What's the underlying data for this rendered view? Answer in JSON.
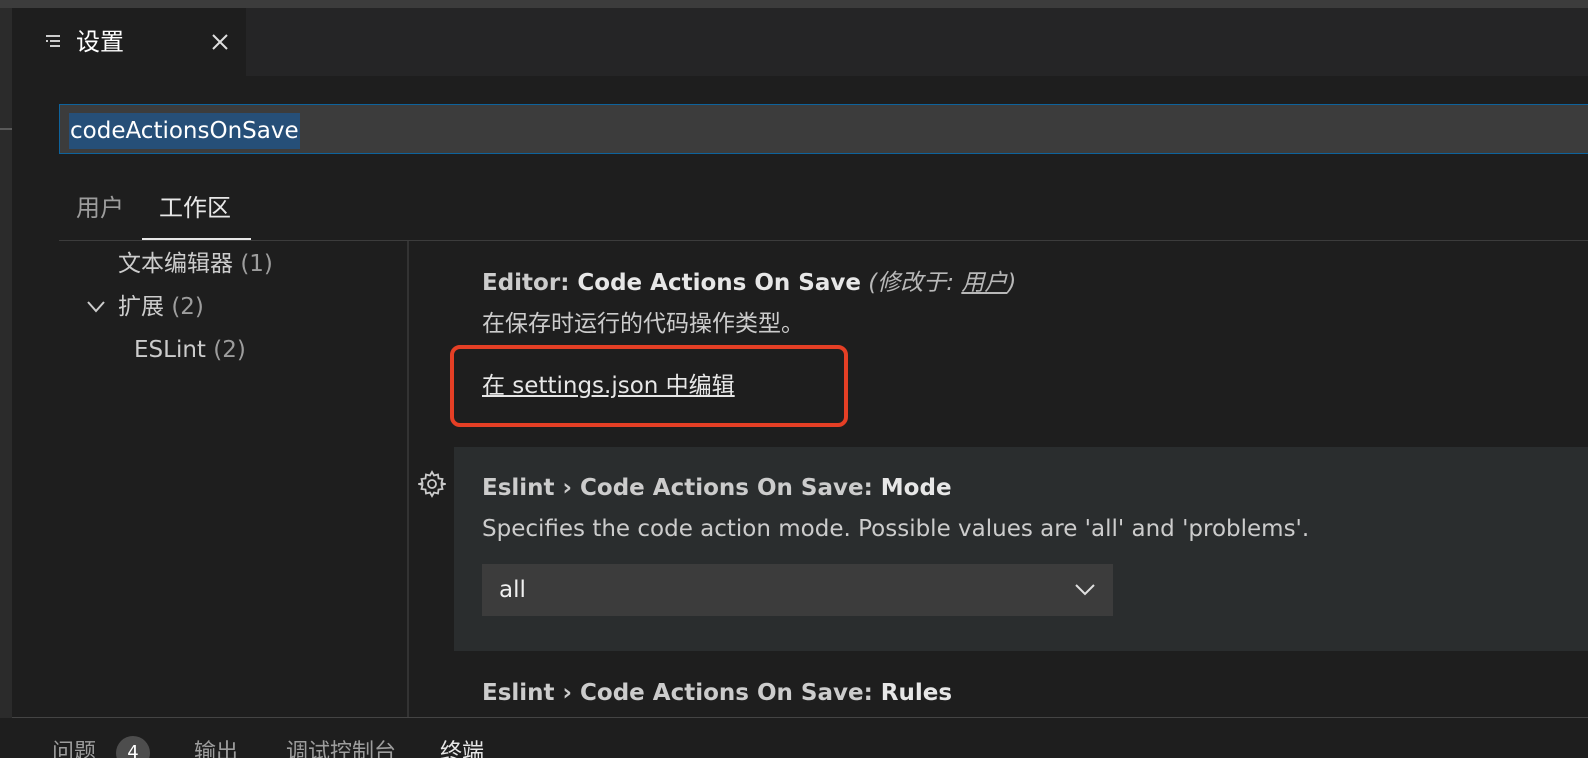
{
  "tab": {
    "title": "设置",
    "icon": "settings-list-icon",
    "close_icon": "close-icon"
  },
  "search": {
    "value": "codeActionsOnSave"
  },
  "scope_tabs": [
    {
      "label": "用户"
    },
    {
      "label": "工作区"
    }
  ],
  "toc": {
    "items": [
      {
        "label": "文本编辑器",
        "count": "(1)"
      },
      {
        "label": "扩展",
        "count": "(2)",
        "expanded": true
      },
      {
        "label": "ESLint",
        "count": "(2)"
      }
    ]
  },
  "settings": [
    {
      "category": "Editor: ",
      "name": "Code Actions On Save",
      "modified_prefix": "(修改于: ",
      "modified_scope": "用户",
      "modified_suffix": ")",
      "description": "在保存时运行的代码操作类型。",
      "edit_link": "在 settings.json 中编辑"
    },
    {
      "category": "Eslint › Code Actions On Save: ",
      "name": "Mode",
      "description": "Specifies the code action mode. Possible values are 'all' and 'problems'.",
      "select_value": "all"
    },
    {
      "category": "Eslint › Code Actions On Save: ",
      "name": "Rules"
    }
  ],
  "panel": {
    "tabs": [
      {
        "label": "问题"
      },
      {
        "label": "输出"
      },
      {
        "label": "调试控制台"
      },
      {
        "label": "终端"
      }
    ],
    "problems_badge": "4"
  },
  "colors": {
    "accent_border": "#0e639c",
    "selection": "#264f78",
    "annotation": "#e53f25"
  }
}
